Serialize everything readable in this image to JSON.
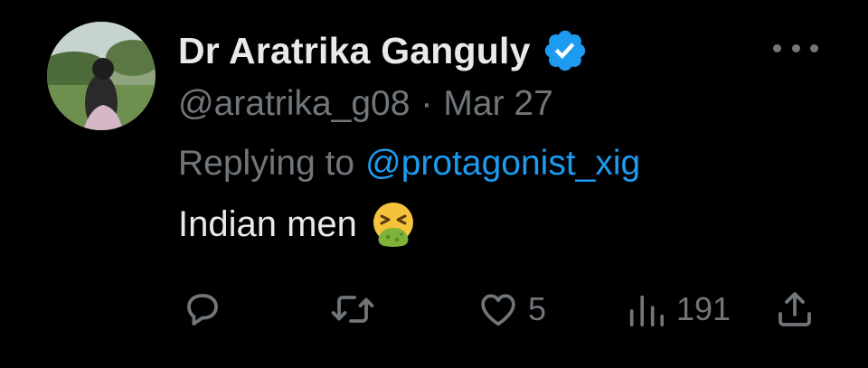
{
  "tweet": {
    "author": {
      "display_name": "Dr Aratrika Ganguly",
      "handle": "@aratrika_g08",
      "verified": true
    },
    "date": "Mar 27",
    "separator": "·",
    "replying_label": "Replying to",
    "replying_to": "@protagonist_xig",
    "text": "Indian men",
    "emoji": "face-vomiting-emoji"
  },
  "actions": {
    "reply": {
      "icon": "reply-icon",
      "count": ""
    },
    "retweet": {
      "icon": "retweet-icon",
      "count": ""
    },
    "like": {
      "icon": "heart-icon",
      "count": "5"
    },
    "views": {
      "icon": "analytics-icon",
      "count": "191"
    },
    "share": {
      "icon": "share-icon"
    }
  },
  "colors": {
    "background": "#000000",
    "primary_text": "#e7e9ea",
    "secondary_text": "#71767b",
    "accent": "#1d9bf0"
  }
}
